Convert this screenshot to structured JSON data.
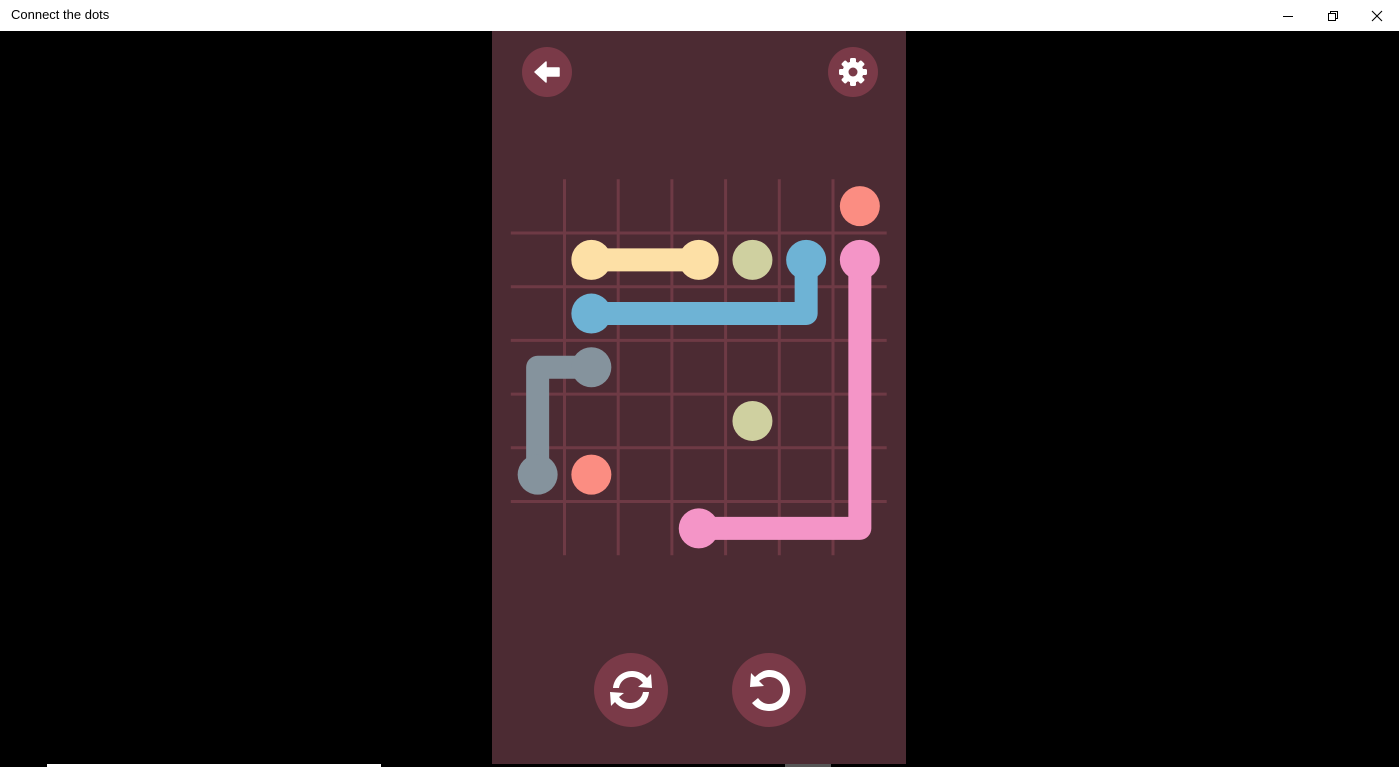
{
  "window": {
    "title": "Connect the dots"
  },
  "icons": {
    "back": "arrow-left-icon",
    "settings": "gear-icon",
    "new_puzzle": "refresh-icon",
    "undo": "undo-icon",
    "minimize": "minimize-icon",
    "restore": "restore-icon",
    "close": "close-icon"
  },
  "colors": {
    "panel": "#4c2b33",
    "button": "#7a3a48",
    "grid": "#6e3a45",
    "yellow": "#fde0a6",
    "olive": "#cfd0a0",
    "blue": "#6eb3d5",
    "pink": "#f495c7",
    "coral": "#fb8d82",
    "gray": "#85939d"
  },
  "board": {
    "cols": 7,
    "rows": 7,
    "dots": [
      {
        "color": "coral",
        "col": 6,
        "row": 0
      },
      {
        "color": "yellow",
        "col": 1,
        "row": 1
      },
      {
        "color": "yellow",
        "col": 3,
        "row": 1
      },
      {
        "color": "olive",
        "col": 4,
        "row": 1
      },
      {
        "color": "blue",
        "col": 5,
        "row": 1
      },
      {
        "color": "pink",
        "col": 6,
        "row": 1
      },
      {
        "color": "blue",
        "col": 1,
        "row": 2
      },
      {
        "color": "gray",
        "col": 1,
        "row": 3
      },
      {
        "color": "olive",
        "col": 4,
        "row": 4
      },
      {
        "color": "gray",
        "col": 0,
        "row": 5
      },
      {
        "color": "coral",
        "col": 1,
        "row": 5
      },
      {
        "color": "pink",
        "col": 3,
        "row": 6
      }
    ],
    "paths": [
      {
        "color": "yellow",
        "cells": [
          [
            1,
            1
          ],
          [
            2,
            1
          ],
          [
            3,
            1
          ]
        ]
      },
      {
        "color": "blue",
        "cells": [
          [
            5,
            1
          ],
          [
            5,
            2
          ],
          [
            4,
            2
          ],
          [
            3,
            2
          ],
          [
            2,
            2
          ],
          [
            1,
            2
          ]
        ]
      },
      {
        "color": "gray",
        "cells": [
          [
            1,
            3
          ],
          [
            0,
            3
          ],
          [
            0,
            4
          ],
          [
            0,
            5
          ]
        ]
      },
      {
        "color": "pink",
        "cells": [
          [
            6,
            1
          ],
          [
            6,
            2
          ],
          [
            6,
            3
          ],
          [
            6,
            4
          ],
          [
            6,
            5
          ],
          [
            6,
            6
          ],
          [
            5,
            6
          ],
          [
            4,
            6
          ],
          [
            3,
            6
          ]
        ]
      }
    ]
  }
}
